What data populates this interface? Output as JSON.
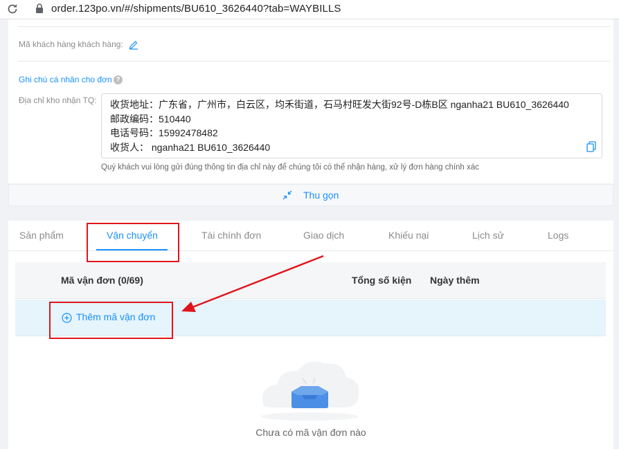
{
  "browser": {
    "url": "order.123po.vn/#/shipments/BU610_3626440?tab=WAYBILLS"
  },
  "info": {
    "customer_code_label": "Mã khách hàng khách hàng:",
    "note_link": "Ghi chú cá nhân cho đơn",
    "help_icon_glyph": "?",
    "warehouse_label": "Địa chỉ kho nhận TQ:",
    "address_lines": [
      "收货地址：广东省，广州市，白云区，均禾街道，石马村旺发大街92号-D栋B区 nganha21 BU610_3626440",
      "邮政编码：510440",
      "电话号码：15992478482",
      "收货人：  nganha21 BU610_3626440"
    ],
    "address_hint": "Quý khách vui lòng gửi đúng thông tin địa chỉ này để chúng tôi có thể nhận hàng, xử lý đơn hàng chính xác",
    "collapse_label": "Thu gọn"
  },
  "tabs": [
    {
      "label": "Sản phẩm",
      "active": false
    },
    {
      "label": "Vận chuyển",
      "active": true
    },
    {
      "label": "Tài chính đơn",
      "active": false
    },
    {
      "label": "Giao dịch",
      "active": false
    },
    {
      "label": "Khiếu nại",
      "active": false
    },
    {
      "label": "Lịch sử",
      "active": false
    },
    {
      "label": "Logs",
      "active": false
    }
  ],
  "waybills": {
    "columns": [
      "Mã vận đơn (0/69)",
      "Tổng số kiện",
      "Ngày thêm"
    ],
    "add_label": "Thêm mã vận đơn",
    "empty_text": "Chưa có mã vận đơn nào"
  },
  "icons": {
    "reload": "reload-icon",
    "lock": "lock-icon",
    "edit": "edit-icon",
    "copy": "copy-icon",
    "collapse": "collapse-arrows-icon",
    "add": "plus-circle-icon",
    "empty": "empty-box-icon"
  },
  "colors": {
    "accent": "#1890ff",
    "annotation_red": "#e0151b",
    "add_row_bg": "#e6f4fc"
  }
}
